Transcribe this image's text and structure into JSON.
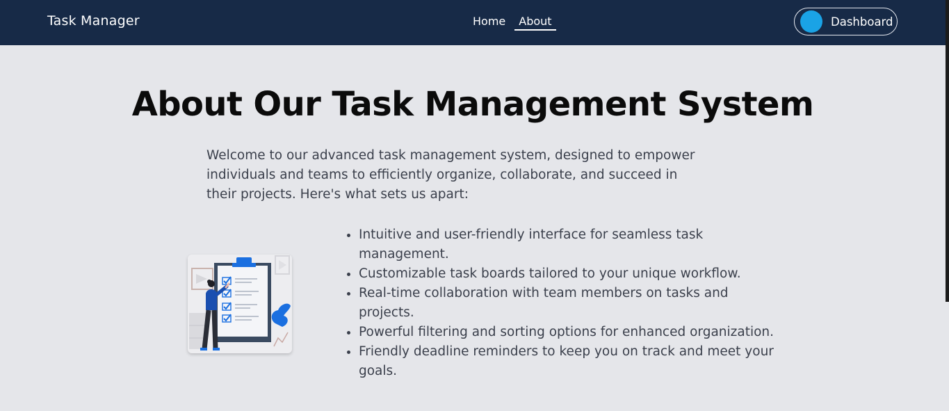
{
  "nav": {
    "brand": "Task Manager",
    "links": [
      {
        "label": "Home",
        "active": false
      },
      {
        "label": "About",
        "active": true
      }
    ],
    "dashboard_label": "Dashboard"
  },
  "about": {
    "title": "About Our Task Management System",
    "intro": "Welcome to our advanced task management system, designed to empower individuals and teams to efficiently organize, collaborate, and succeed in their projects. Here's what sets us apart:",
    "features": [
      "Intuitive and user-friendly interface for seamless task management.",
      "Customizable task boards tailored to your unique workflow.",
      "Real-time collaboration with team members on tasks and projects.",
      "Powerful filtering and sorting options for enhanced organization.",
      "Friendly deadline reminders to keep you on track and meet your goals."
    ],
    "illustration_icon": "checklist-illustration"
  },
  "colors": {
    "navbar_bg": "#172a47",
    "page_bg": "#e5e6ea",
    "accent": "#1a6fe0",
    "avatar_bg": "#1aa3e6"
  }
}
